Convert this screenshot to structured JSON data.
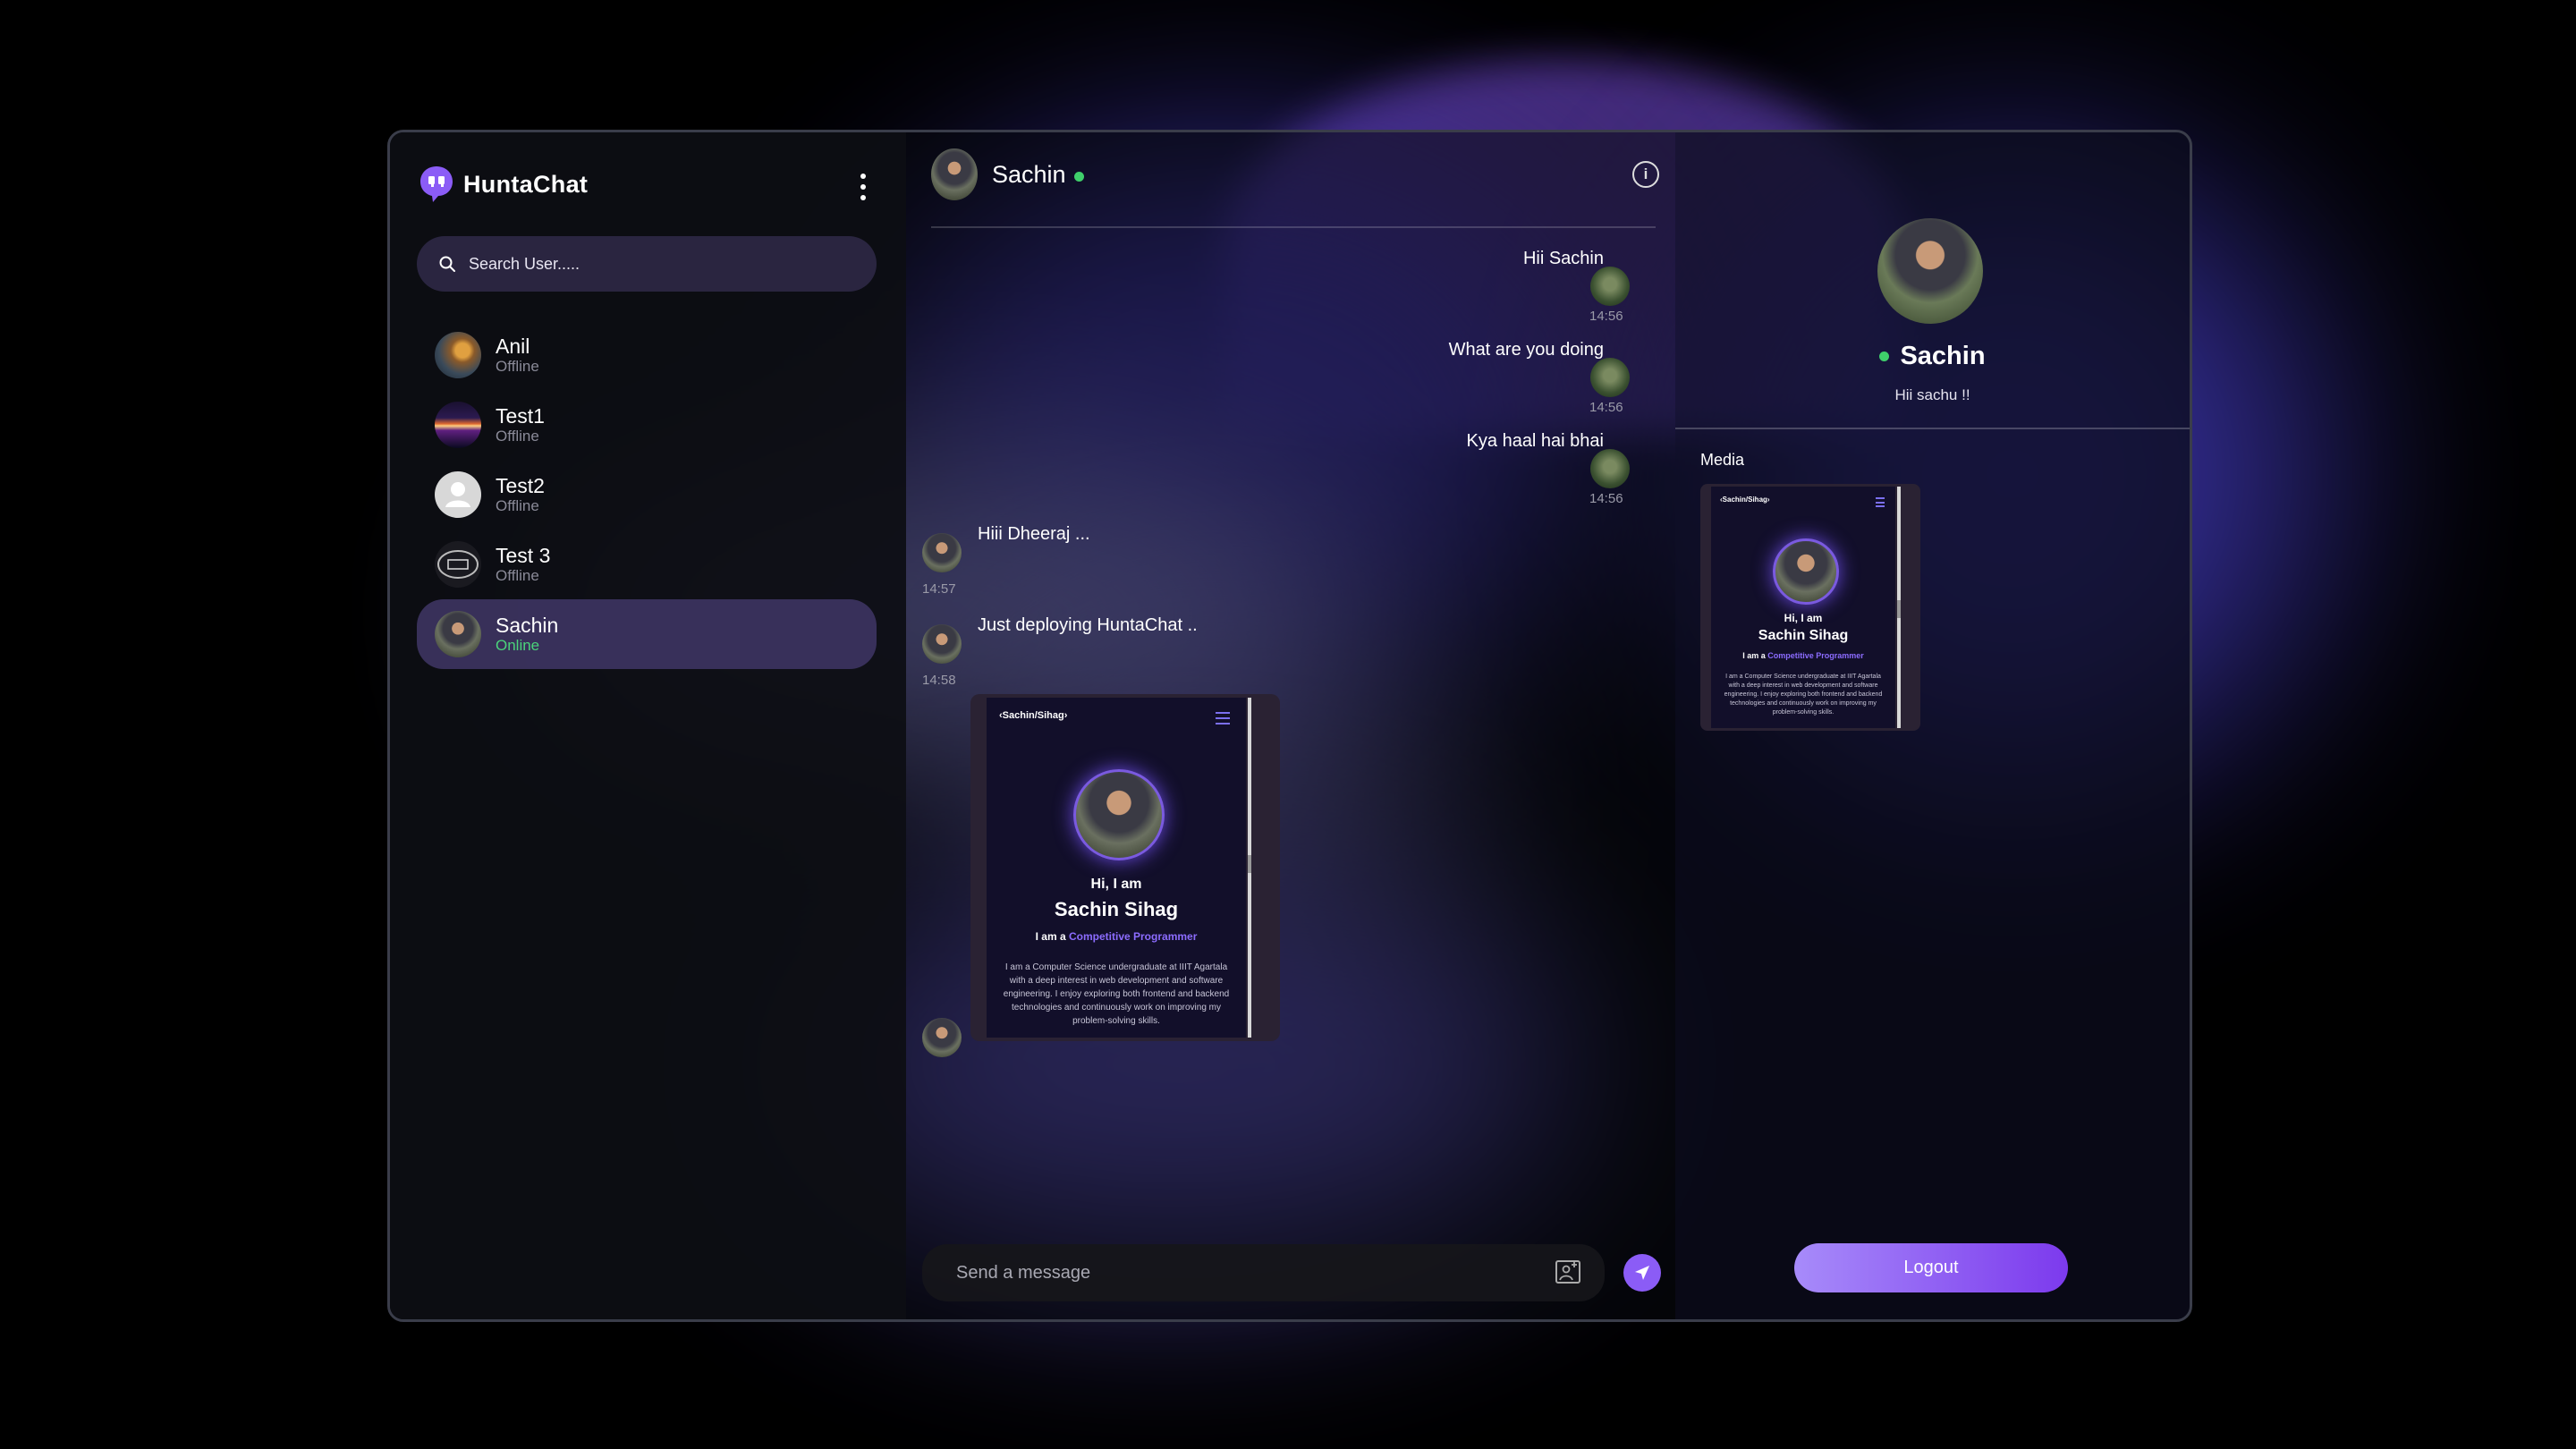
{
  "app": {
    "name": "HuntaChat"
  },
  "search": {
    "placeholder": "Search User....."
  },
  "users": [
    {
      "name": "Anil",
      "status": "Offline"
    },
    {
      "name": "Test1",
      "status": "Offline"
    },
    {
      "name": "Test2",
      "status": "Offline"
    },
    {
      "name": "Test 3",
      "status": "Offline"
    },
    {
      "name": "Sachin",
      "status": "Online"
    }
  ],
  "chat": {
    "contact_name": "Sachin",
    "messages": [
      {
        "text": "Hii Sachin",
        "time": "14:56",
        "side": "sent"
      },
      {
        "text": "What are you doing",
        "time": "14:56",
        "side": "sent"
      },
      {
        "text": "Kya haal hai bhai",
        "time": "14:56",
        "side": "sent"
      },
      {
        "text": "Hiii Dheeraj ...",
        "time": "14:57",
        "side": "received"
      },
      {
        "text": "Just deploying HuntaChat ..",
        "time": "14:58",
        "side": "received"
      }
    ],
    "shared_image": {
      "nav": "‹Sachin/Sihag›",
      "greeting": "Hi, I am",
      "name": "Sachin Sihag",
      "role_prefix": "I am a",
      "role": "Competitive Programmer",
      "bio": "I am a Computer Science undergraduate at IIIT Agartala with a deep interest in web development and software engineering. I enjoy exploring both frontend and backend technologies and continuously work on improving my problem-solving skills."
    },
    "composer_placeholder": "Send a message"
  },
  "profile": {
    "name": "Sachin",
    "bio": "Hii sachu !!",
    "media_label": "Media",
    "logout_label": "Logout"
  },
  "colors": {
    "accent": "#8b5cf6",
    "online": "#3fcf6b"
  },
  "icons": [
    "chat-logo-icon",
    "kebab-menu-icon",
    "search-icon",
    "info-icon",
    "image-attach-icon",
    "send-icon"
  ]
}
